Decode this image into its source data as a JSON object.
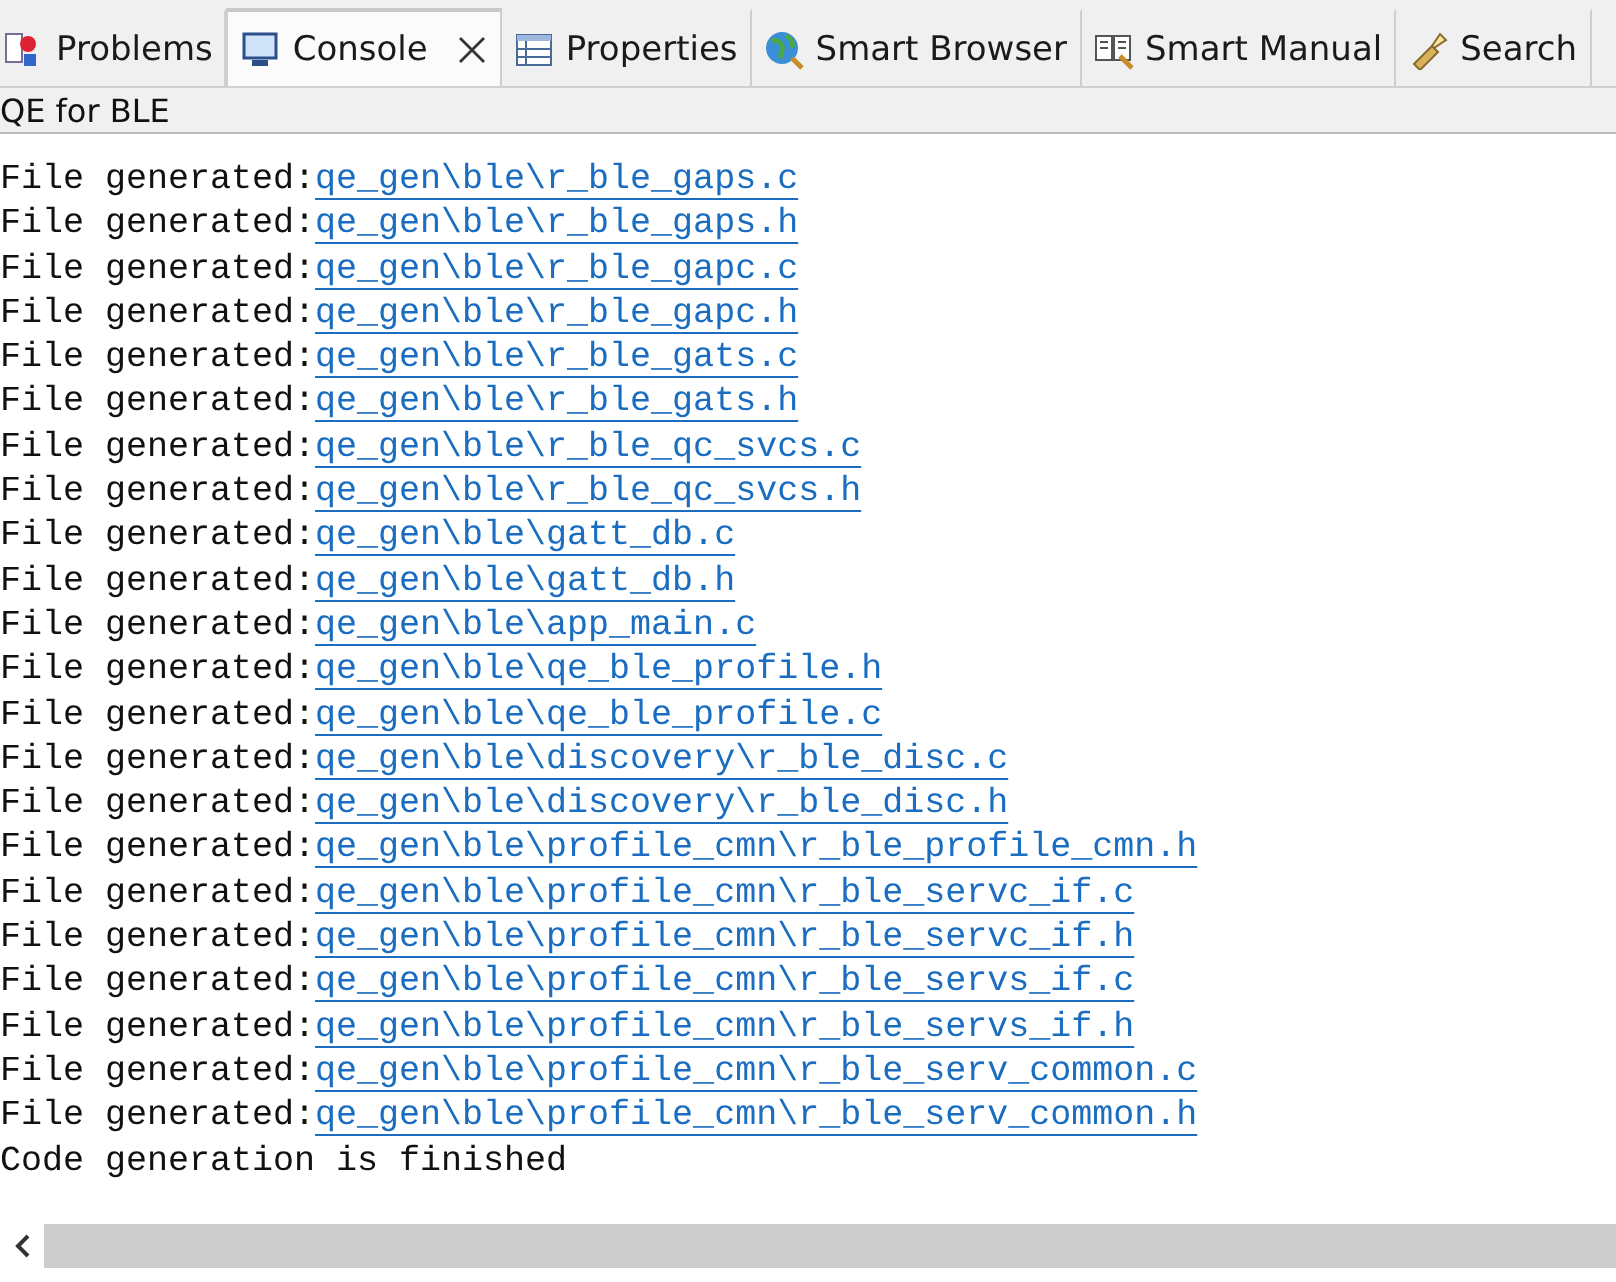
{
  "tabs": [
    {
      "label": "Problems",
      "selected": false,
      "closable": false
    },
    {
      "label": "Console",
      "selected": true,
      "closable": true
    },
    {
      "label": "Properties",
      "selected": false,
      "closable": false
    },
    {
      "label": "Smart Browser",
      "selected": false,
      "closable": false
    },
    {
      "label": "Smart Manual",
      "selected": false,
      "closable": false
    },
    {
      "label": "Search",
      "selected": false,
      "closable": false
    }
  ],
  "console": {
    "title": "QE for BLE",
    "lines": [
      {
        "kind": "file",
        "prefix": "File generated:",
        "link": "qe_gen\\ble\\r_ble_gaps.c"
      },
      {
        "kind": "file",
        "prefix": "File generated:",
        "link": "qe_gen\\ble\\r_ble_gaps.h"
      },
      {
        "kind": "file",
        "prefix": "File generated:",
        "link": "qe_gen\\ble\\r_ble_gapc.c"
      },
      {
        "kind": "file",
        "prefix": "File generated:",
        "link": "qe_gen\\ble\\r_ble_gapc.h"
      },
      {
        "kind": "file",
        "prefix": "File generated:",
        "link": "qe_gen\\ble\\r_ble_gats.c"
      },
      {
        "kind": "file",
        "prefix": "File generated:",
        "link": "qe_gen\\ble\\r_ble_gats.h"
      },
      {
        "kind": "file",
        "prefix": "File generated:",
        "link": "qe_gen\\ble\\r_ble_qc_svcs.c"
      },
      {
        "kind": "file",
        "prefix": "File generated:",
        "link": "qe_gen\\ble\\r_ble_qc_svcs.h"
      },
      {
        "kind": "file",
        "prefix": "File generated:",
        "link": "qe_gen\\ble\\gatt_db.c"
      },
      {
        "kind": "file",
        "prefix": "File generated:",
        "link": "qe_gen\\ble\\gatt_db.h"
      },
      {
        "kind": "file",
        "prefix": "File generated:",
        "link": "qe_gen\\ble\\app_main.c"
      },
      {
        "kind": "file",
        "prefix": "File generated:",
        "link": "qe_gen\\ble\\qe_ble_profile.h"
      },
      {
        "kind": "file",
        "prefix": "File generated:",
        "link": "qe_gen\\ble\\qe_ble_profile.c"
      },
      {
        "kind": "file",
        "prefix": "File generated:",
        "link": "qe_gen\\ble\\discovery\\r_ble_disc.c"
      },
      {
        "kind": "file",
        "prefix": "File generated:",
        "link": "qe_gen\\ble\\discovery\\r_ble_disc.h"
      },
      {
        "kind": "file",
        "prefix": "File generated:",
        "link": "qe_gen\\ble\\profile_cmn\\r_ble_profile_cmn.h"
      },
      {
        "kind": "file",
        "prefix": "File generated:",
        "link": "qe_gen\\ble\\profile_cmn\\r_ble_servc_if.c"
      },
      {
        "kind": "file",
        "prefix": "File generated:",
        "link": "qe_gen\\ble\\profile_cmn\\r_ble_servc_if.h"
      },
      {
        "kind": "file",
        "prefix": "File generated:",
        "link": "qe_gen\\ble\\profile_cmn\\r_ble_servs_if.c"
      },
      {
        "kind": "file",
        "prefix": "File generated:",
        "link": "qe_gen\\ble\\profile_cmn\\r_ble_servs_if.h"
      },
      {
        "kind": "file",
        "prefix": "File generated:",
        "link": "qe_gen\\ble\\profile_cmn\\r_ble_serv_common.c"
      },
      {
        "kind": "file",
        "prefix": "File generated:",
        "link": "qe_gen\\ble\\profile_cmn\\r_ble_serv_common.h"
      },
      {
        "kind": "text",
        "text": "Code generation is finished"
      }
    ]
  }
}
